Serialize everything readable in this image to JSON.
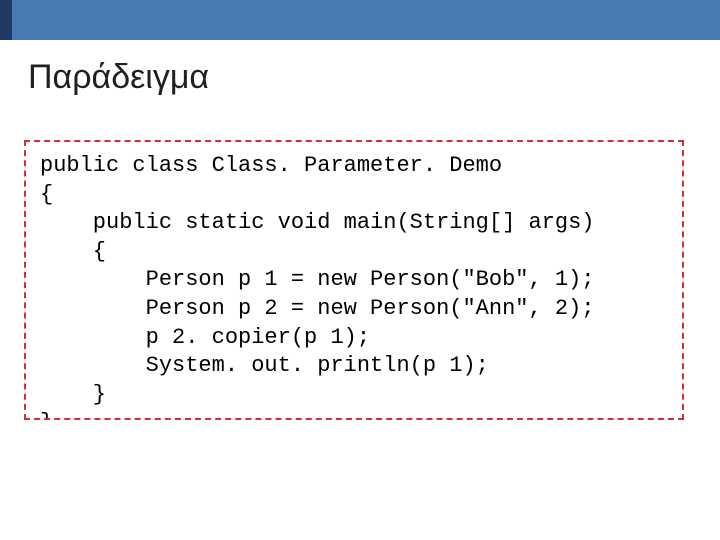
{
  "title": "Παράδειγμα",
  "code": {
    "l1": "public class Class. Parameter. Demo",
    "l2": "{",
    "l3": "    public static void main(String[] args)",
    "l4": "    {",
    "l5": "        Person p 1 = new Person(\"Bob\", 1);",
    "l6": "        Person p 2 = new Person(\"Ann\", 2);",
    "l7": "        p 2. copier(p 1);",
    "l8": "        System. out. println(p 1);",
    "l9": "    }",
    "l10": "}"
  }
}
